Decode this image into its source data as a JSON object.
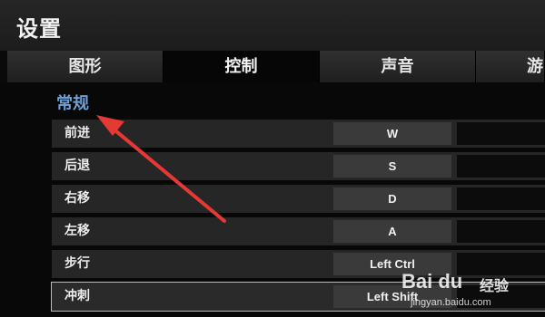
{
  "window": {
    "title": "设置"
  },
  "tabs": [
    {
      "label": "图形",
      "active": false
    },
    {
      "label": "控制",
      "active": true
    },
    {
      "label": "声音",
      "active": false
    },
    {
      "label": "游",
      "active": false
    }
  ],
  "section": {
    "title": "常规"
  },
  "bindings": [
    {
      "action": "前进",
      "key": "W"
    },
    {
      "action": "后退",
      "key": "S"
    },
    {
      "action": "右移",
      "key": "D"
    },
    {
      "action": "左移",
      "key": "A"
    },
    {
      "action": "步行",
      "key": "Left Ctrl"
    },
    {
      "action": "冲刺",
      "key": "Left Shift"
    }
  ],
  "annotation": {
    "arrow_color": "#e53935"
  },
  "watermark": {
    "logo": "Bai du",
    "brand": "经验",
    "url": "jingyan.baidu.com"
  },
  "colors": {
    "section_title": "#6f9fd4",
    "background": "#080808"
  }
}
